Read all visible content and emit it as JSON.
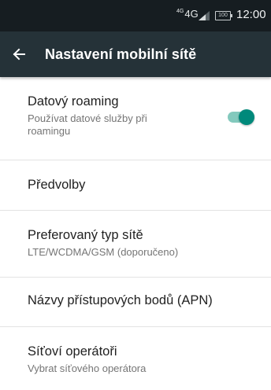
{
  "status_bar": {
    "network_superscript": "4G",
    "network_label": "4G",
    "battery_label": "100",
    "time": "12:00"
  },
  "app_bar": {
    "back_icon": "arrow-back-icon",
    "title": "Nastavení mobilní sítě"
  },
  "settings": {
    "data_roaming": {
      "title": "Datový roaming",
      "summary": "Používat datové služby při roamingu",
      "enabled": true
    },
    "predvolby": {
      "title": "Předvolby"
    },
    "preferred_network": {
      "title": "Preferovaný typ sítě",
      "summary": "LTE/WCDMA/GSM (doporučeno)"
    },
    "apn": {
      "title": "Názvy přístupových bodů (APN)"
    },
    "operators": {
      "title": "Síťoví operátoři",
      "summary": "Vybrat síťového operátora"
    }
  },
  "colors": {
    "status_bar_bg": "#161d21",
    "app_bar_bg": "#253238",
    "toggle_thumb": "#00897b",
    "toggle_track": "#83c9bd"
  }
}
